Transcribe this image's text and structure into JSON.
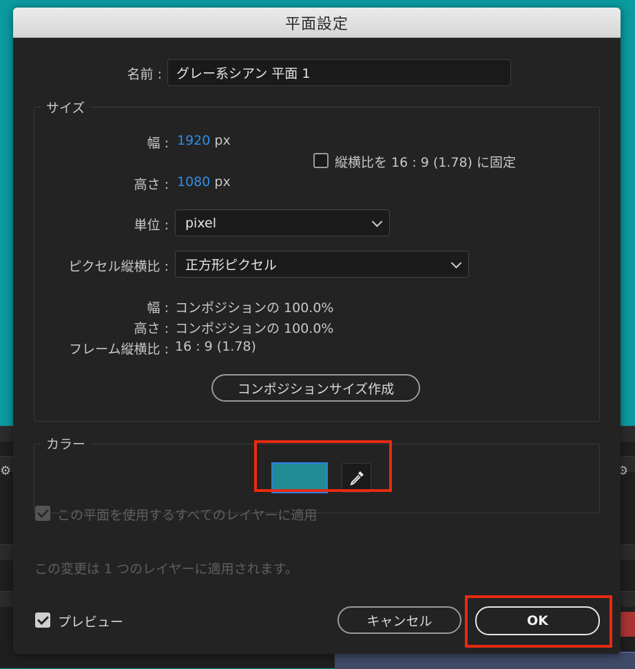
{
  "dialog": {
    "title": "平面設定"
  },
  "name": {
    "label": "名前 :",
    "value": "グレー系シアン 平面 1"
  },
  "size": {
    "group_title": "サイズ",
    "width_label": "幅 :",
    "width_value": "1920",
    "width_unit": "px",
    "height_label": "高さ :",
    "height_value": "1080",
    "height_unit": "px",
    "lock_aspect_label": "縦横比を 16 : 9 (1.78) に固定",
    "units_label": "単位 :",
    "units_value": "pixel",
    "pixel_aspect_label": "ピクセル縦横比 :",
    "pixel_aspect_value": "正方形ピクセル",
    "info_width_label": "幅 :",
    "info_width_value": "コンポジションの 100.0%",
    "info_height_label": "高さ :",
    "info_height_value": "コンポジションの 100.0%",
    "frame_aspect_label": "フレーム縦横比 :",
    "frame_aspect_value": "16 : 9 (1.78)",
    "make_comp_size_button": "コンポジションサイズ作成"
  },
  "color": {
    "group_title": "カラー",
    "swatch_color": "#1f8c93",
    "accent_blue": "#2f8ee8"
  },
  "apply_all": {
    "label": "この平面を使用するすべてのレイヤーに適用",
    "checked": true
  },
  "notice": "この変更は 1 つのレイヤーに適用されます。",
  "preview": {
    "label": "プレビュー",
    "checked": true
  },
  "buttons": {
    "cancel": "キャンセル",
    "ok": "OK"
  },
  "highlight_color": "#ea2a10"
}
